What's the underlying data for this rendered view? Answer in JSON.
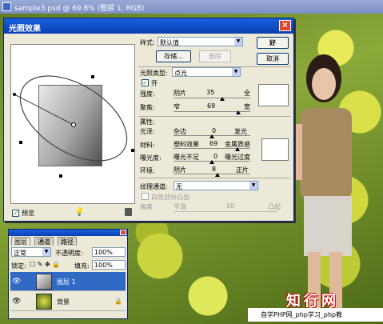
{
  "document": {
    "title": "sample3.psd @ 69.8% (图层 1, RGB)"
  },
  "dialog": {
    "title": "光照效果",
    "style_label": "样式:",
    "style_value": "默认值",
    "save_button": "存储...",
    "delete_button": "删除",
    "ok_button": "好",
    "cancel_button": "取消",
    "light_type_label": "光照类型:",
    "light_type_value": "点光",
    "on_label": "开",
    "intensity_label": "强度:",
    "intensity_left": "阴片",
    "intensity_value": "35",
    "intensity_right": "全",
    "focus_label": "聚焦:",
    "focus_left": "窄",
    "focus_value": "69",
    "focus_right": "宽",
    "properties_label": "属性:",
    "gloss_label": "光泽:",
    "gloss_left": "杂边",
    "gloss_value": "0",
    "gloss_right": "发光",
    "material_label": "材料:",
    "material_left": "塑料效果",
    "material_value": "69",
    "material_right": "金属质感",
    "exposure_label": "曝光度:",
    "exposure_left": "曝光不足",
    "exposure_value": "0",
    "exposure_right": "曝光过度",
    "ambience_label": "环境:",
    "ambience_left": "阴片",
    "ambience_value": "8",
    "ambience_right": "正片",
    "texture_label": "纹理通道:",
    "texture_value": "无",
    "white_high_label": "白色部分凸出",
    "height_label": "高度",
    "height_left": "平滑",
    "height_value": "50",
    "height_right": "凸起",
    "preview_label": "预览",
    "preview_checked": true,
    "on_checked": true
  },
  "layers_panel": {
    "tabs": [
      "图层",
      "通道",
      "路径"
    ],
    "blend_mode": "正常",
    "opacity_label": "不透明度:",
    "opacity_value": "100%",
    "lock_label": "锁定:",
    "fill_label": "填充:",
    "fill_value": "100%",
    "layers": [
      {
        "name": "图层 1",
        "selected": true
      },
      {
        "name": "背景",
        "selected": false
      }
    ]
  },
  "watermark": {
    "logo": "知行网",
    "text": "自学PHP网_php学习_php教"
  },
  "colors": {
    "dialog_bg": "#ece9d8",
    "titlebar": "#0a3fb0",
    "selected_layer": "#316ac5"
  }
}
